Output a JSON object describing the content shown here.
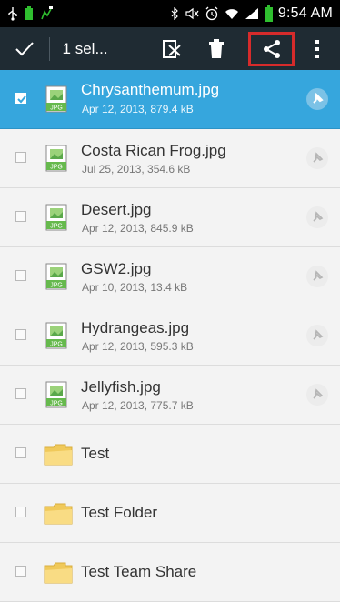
{
  "status_bar": {
    "time": "9:54 AM",
    "icons": [
      "usb-icon",
      "battery-small-icon",
      "notification-icon",
      "bluetooth-icon",
      "mute-icon",
      "alarm-icon",
      "wifi-icon",
      "signal-icon",
      "battery-icon"
    ],
    "battery_color": "#2fbf2f"
  },
  "action_bar": {
    "title": "1 sel...",
    "icons": [
      "check-icon",
      "cut-icon",
      "trash-icon",
      "share-icon",
      "overflow-menu-icon"
    ],
    "highlight_color": "#d62b2b"
  },
  "items": [
    {
      "kind": "file",
      "name": "Chrysanthemum.jpg",
      "meta": "Apr 12, 2013, 879.4 kB",
      "selected": true,
      "thumb_label": "JPG"
    },
    {
      "kind": "file",
      "name": "Costa Rican Frog.jpg",
      "meta": "Jul 25, 2013, 354.6 kB",
      "selected": false,
      "thumb_label": "JPG"
    },
    {
      "kind": "file",
      "name": "Desert.jpg",
      "meta": "Apr 12, 2013, 845.9 kB",
      "selected": false,
      "thumb_label": "JPG"
    },
    {
      "kind": "file",
      "name": "GSW2.jpg",
      "meta": "Apr 10, 2013, 13.4 kB",
      "selected": false,
      "thumb_label": "JPG"
    },
    {
      "kind": "file",
      "name": "Hydrangeas.jpg",
      "meta": "Apr 12, 2013, 595.3 kB",
      "selected": false,
      "thumb_label": "JPG"
    },
    {
      "kind": "file",
      "name": "Jellyfish.jpg",
      "meta": "Apr 12, 2013, 775.7 kB",
      "selected": false,
      "thumb_label": "JPG"
    },
    {
      "kind": "folder",
      "name": "Test",
      "selected": false
    },
    {
      "kind": "folder",
      "name": "Test Folder",
      "selected": false
    },
    {
      "kind": "folder",
      "name": "Test Team Share",
      "selected": false
    }
  ],
  "colors": {
    "selection": "#36a6dd",
    "action_bar": "#1f2b33",
    "folder": "#f6d36a"
  }
}
